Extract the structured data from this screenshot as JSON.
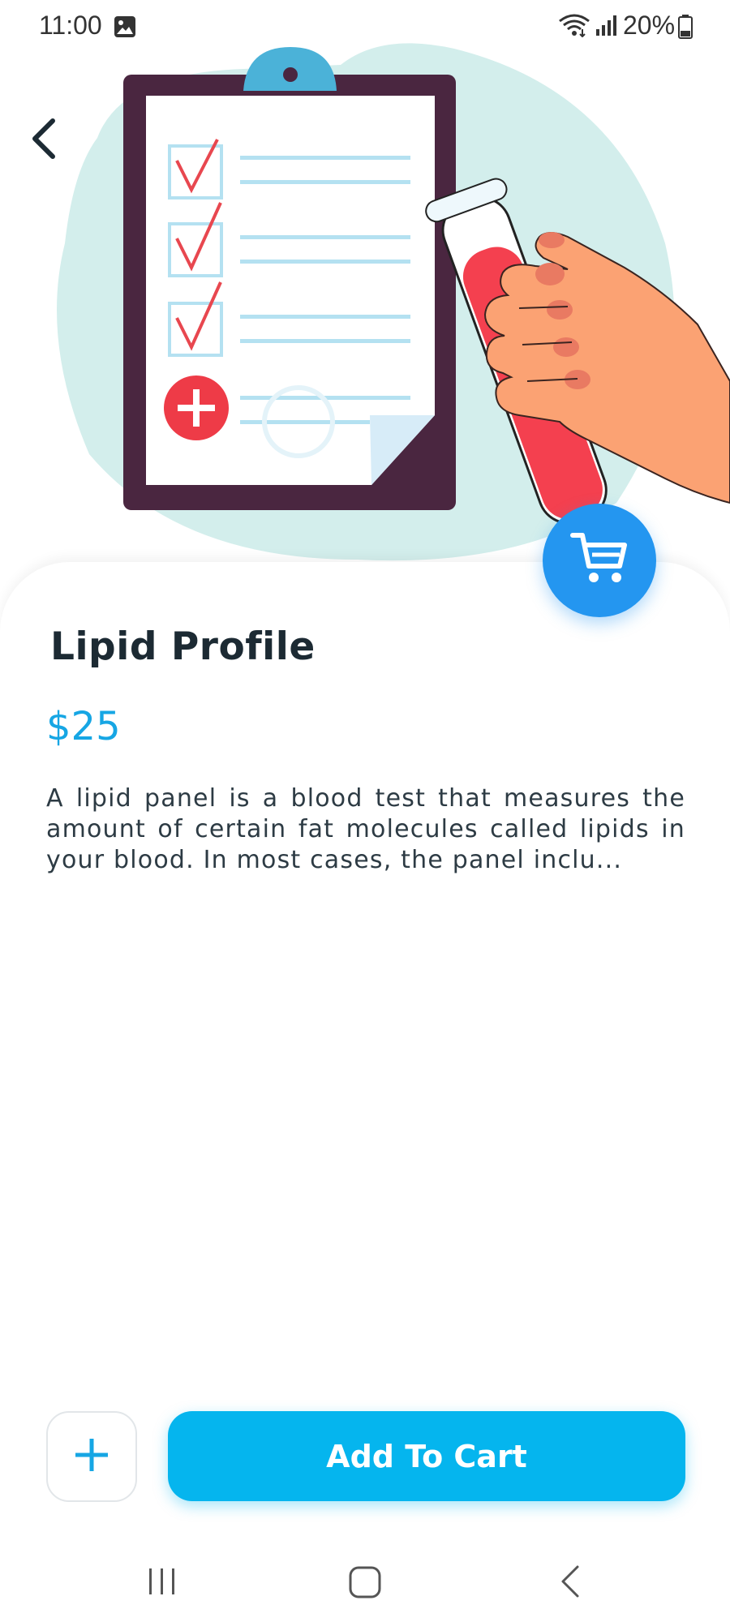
{
  "status_bar": {
    "time": "11:00",
    "battery_percent": "20%",
    "icons": [
      "gallery-icon",
      "wifi-icon",
      "signal-icon",
      "battery-icon"
    ]
  },
  "hero": {
    "illustration": "clipboard-checklist-and-blood-test-tube-illustration",
    "back_icon": "chevron-left-icon",
    "cart_icon": "shopping-cart-icon"
  },
  "product": {
    "title": "Lipid Profile",
    "price": "$25",
    "description": "A lipid panel is a blood test that measures the amount of certain fat molecules called lipids in your blood. In most cases, the panel inclu..."
  },
  "actions": {
    "plus_icon": "plus-icon",
    "add_to_cart_label": "Add To Cart"
  },
  "colors": {
    "accent": "#05b5ee",
    "price": "#16a6e4",
    "fab": "#2496f0",
    "title": "#1c2a33"
  },
  "nav_bar": {
    "icons": [
      "recents-icon",
      "home-icon",
      "back-icon"
    ]
  }
}
